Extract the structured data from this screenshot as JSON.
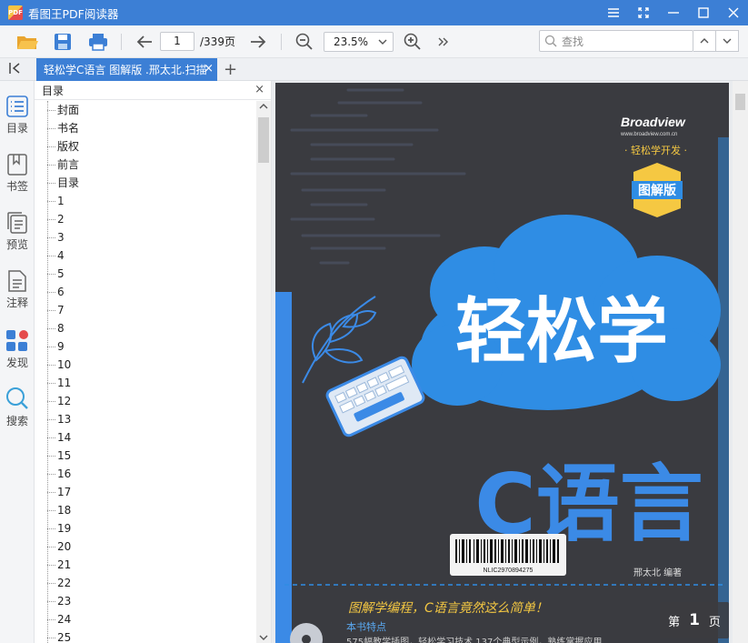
{
  "window": {
    "logo_text": "PDF",
    "title": "看图王PDF阅读器"
  },
  "toolbar": {
    "page_current": "1",
    "page_total": "/339页",
    "zoom": "23.5%",
    "search_placeholder": "查找"
  },
  "tabs": [
    {
      "label": "轻松学C语言 图解版 .邢太北.扫描",
      "close": "×"
    }
  ],
  "tab_add": "+",
  "sidebar": {
    "items": [
      {
        "label": "目录",
        "icon": "outline-icon"
      },
      {
        "label": "书签",
        "icon": "bookmark-icon"
      },
      {
        "label": "预览",
        "icon": "thumbnails-icon"
      },
      {
        "label": "注释",
        "icon": "annotation-icon"
      },
      {
        "label": "发现",
        "icon": "discover-icon"
      },
      {
        "label": "搜索",
        "icon": "search-icon"
      }
    ]
  },
  "outline": {
    "title": "目录",
    "close": "×",
    "items": [
      "封面",
      "书名",
      "版权",
      "前言",
      "目录",
      "1",
      "2",
      "3",
      "4",
      "5",
      "6",
      "7",
      "8",
      "9",
      "10",
      "11",
      "12",
      "13",
      "14",
      "15",
      "16",
      "17",
      "18",
      "19",
      "20",
      "21",
      "22",
      "23",
      "24",
      "25"
    ]
  },
  "cover": {
    "publisher": "Broadview",
    "publisher_url": "www.broadview.com.cn",
    "series": "· 轻松学开发 ·",
    "badge": "图解版",
    "title_main": "轻松学",
    "title_sub": "C语言",
    "barcode_text": "NLIC2970894275",
    "author": "邢太北  编著",
    "slogan": "图解学编程，C语言竟然这么简单！",
    "features_title": "本书特点",
    "features_line": "575幅教学插图，轻松学习技术  137个典型示例，熟练掌握应用"
  },
  "page_indicator": {
    "prefix": "第",
    "number": "1",
    "suffix": "页"
  },
  "colors": {
    "accent": "#3c7fd5",
    "cover_bg": "#3a3b40",
    "cloud": "#2f8de4",
    "title_blue": "#3b8ae6",
    "badge": "#f5c842"
  }
}
